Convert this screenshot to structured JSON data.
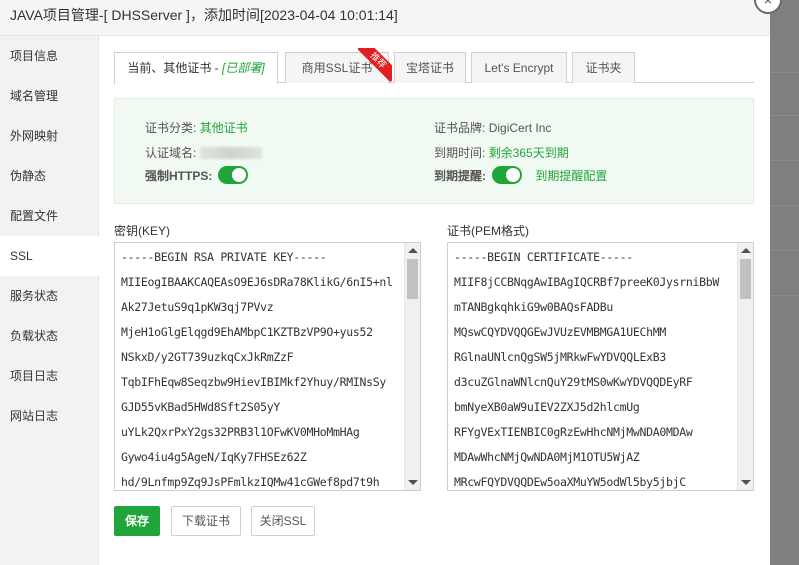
{
  "dialog": {
    "title": "JAVA项目管理-[ DHSServer ]，添加时间[2023-04-04 10:01:14]",
    "close_glyph": "×"
  },
  "sidebar": {
    "items": [
      {
        "label": "项目信息"
      },
      {
        "label": "域名管理"
      },
      {
        "label": "外网映射"
      },
      {
        "label": "伪静态"
      },
      {
        "label": "配置文件"
      },
      {
        "label": "SSL"
      },
      {
        "label": "服务状态"
      },
      {
        "label": "负载状态"
      },
      {
        "label": "项目日志"
      },
      {
        "label": "网站日志"
      }
    ],
    "active_index": 5
  },
  "tabs": {
    "current_prefix": "当前、其他证书 - ",
    "current_suffix": "[已部署]",
    "commercial": "商用SSL证书",
    "commercial_badge": "推荐",
    "baota": "宝塔证书",
    "letsencrypt": "Let's Encrypt",
    "cert_folder": "证书夹"
  },
  "cert_info": {
    "category_label": "证书分类:",
    "category_value": "其他证书",
    "brand_label": "证书品牌:",
    "brand_value": "DigiCert Inc",
    "domain_label": "认证域名:",
    "expiry_label": "到期时间:",
    "expiry_value": "剩余365天到期",
    "force_https_label": "强制HTTPS:",
    "force_https_on": true,
    "reminder_label": "到期提醒:",
    "reminder_on": true,
    "reminder_config": "到期提醒配置"
  },
  "key_field": {
    "label": "密钥(KEY)",
    "lines": [
      "-----BEGIN RSA PRIVATE KEY-----",
      "MIIEogIBAAKCAQEAsO9EJ6sDRa78KlikG/6nI5+nl",
      "Ak27JetuS9q1pKW3qj7PVvz",
      "MjeH1oGlgElqgd9EhAMbpC1KZTBzVP9O+yus52",
      "NSkxD/y2GT739uzkqCxJkRmZzF",
      "TqbIFhEqw8Seqzbw9HievIBIMkf2Yhuy/RMINsSy",
      "GJD55vKBad5HWd8Sft2S05yY",
      "uYLk2QxrPxY2gs32PRB3l1OFwKV0MHoMmHAg",
      "Gywo4iu4g5AgeN/IqKy7FHSEz62Z",
      "hd/9Lnfmp9Zq9JsPFmlkzIQMw41cGWef8pd7t9h"
    ]
  },
  "cert_field": {
    "label": "证书(PEM格式)",
    "lines": [
      "-----BEGIN CERTIFICATE-----",
      "MIIF8jCCBNqgAwIBAgIQCRBf7preeK0JysrniBbW",
      "mTANBgkqhkiG9w0BAQsFADBu",
      "MQswCQYDVQQGEwJVUzEVMBMGA1UEChMM",
      "RGlnaUNlcnQgSW5jMRkwFwYDVQQLExB3",
      "d3cuZGlnaWNlcnQuY29tMS0wKwYDVQQDEyRF",
      "bmNyeXB0aW9uIEV2ZXJ5d2hlcmUg",
      "RFYgVExTIENBIC0gRzEwHhcNMjMwNDA0MDAw",
      "MDAwWhcNMjQwNDA0MjM1OTU5WjAZ",
      "MRcwFQYDVQQDEw5oaXMuYW5odWl5by5jbjC"
    ]
  },
  "buttons": {
    "save": "保存",
    "download": "下载证书",
    "close_ssl": "关闭SSL"
  }
}
